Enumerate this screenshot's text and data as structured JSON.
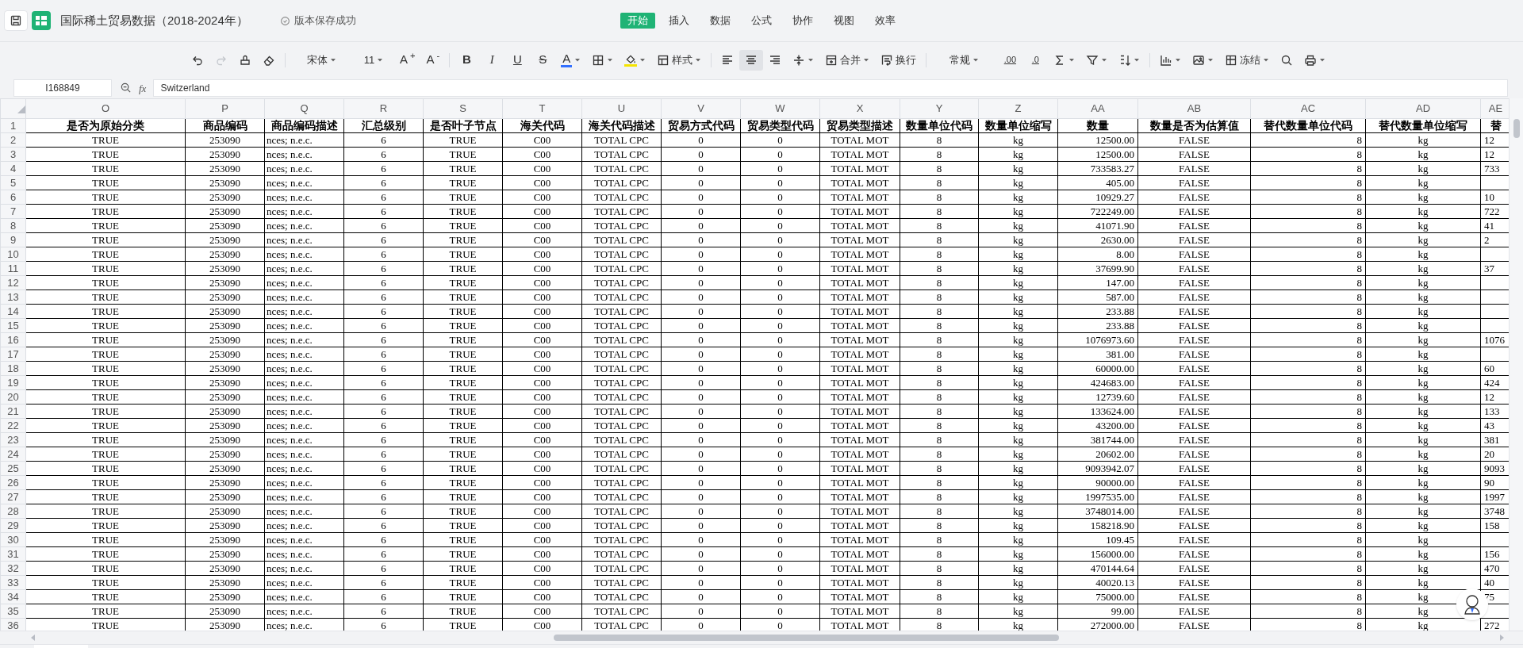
{
  "title_bar": {
    "title": "国际稀土贸易数据（2018-2024年）",
    "save_status": "版本保存成功"
  },
  "menu_tabs": [
    {
      "label": "开始",
      "selected": true
    },
    {
      "label": "插入",
      "selected": false
    },
    {
      "label": "数据",
      "selected": false
    },
    {
      "label": "公式",
      "selected": false
    },
    {
      "label": "协作",
      "selected": false
    },
    {
      "label": "视图",
      "selected": false
    },
    {
      "label": "效率",
      "selected": false
    }
  ],
  "toolbar": {
    "redo": {
      "disabled": true
    },
    "font": "宋体",
    "font_size": "11",
    "size_buttons": [
      "A$^{+}$",
      "A$^{-}$"
    ],
    "text_style_buttons": [
      "B",
      "I",
      "U",
      "S"
    ],
    "font_color_button": {
      "label": "A",
      "color": "#3370ff"
    },
    "fill_color_button": {
      "color": "#f5e400"
    },
    "style_button": "样式",
    "alignment": [
      {
        "selected": false
      },
      {
        "selected": true
      },
      {
        "selected": false
      }
    ],
    "merge_button": "合并",
    "wrap_button": "换行",
    "number_format": "常规",
    "decimal_buttons": [
      ".00",
      ".0"
    ],
    "freeze_button": "冻结"
  },
  "formula_bar": {
    "cell_reference": "I168849",
    "function_label": "fx",
    "value": "Switzerland"
  },
  "sheet": {
    "columns": [
      "O",
      "P",
      "Q",
      "R",
      "S",
      "T",
      "U",
      "V",
      "W",
      "X",
      "Y",
      "Z",
      "AA",
      "AB",
      "AC",
      "AD",
      "AE"
    ],
    "rows": [
      {
        "number": "1",
        "cells": [
          "是否为原始分类",
          "商品编码",
          "商品编码描述",
          "汇总级别",
          "是否叶子节点",
          "海关代码",
          "海关代码描述",
          "贸易方式代码",
          "贸易类型代码",
          "贸易类型描述",
          "数量单位代码",
          "数量单位缩写",
          "数量",
          "数量是否为估算值",
          "替代数量单位代码",
          "替代数量单位缩写",
          "替"
        ]
      },
      {
        "number": "2",
        "cells": [
          "TRUE",
          "253090",
          "nces; n.e.c.",
          "6",
          "TRUE",
          "C00",
          "TOTAL CPC",
          "0",
          "0",
          "TOTAL MOT",
          "8",
          "kg",
          "12500.00",
          "FALSE",
          "8",
          "kg",
          "12"
        ]
      },
      {
        "number": "3",
        "cells": [
          "TRUE",
          "253090",
          "nces; n.e.c.",
          "6",
          "TRUE",
          "C00",
          "TOTAL CPC",
          "0",
          "0",
          "TOTAL MOT",
          "8",
          "kg",
          "12500.00",
          "FALSE",
          "8",
          "kg",
          "12"
        ]
      },
      {
        "number": "4",
        "cells": [
          "TRUE",
          "253090",
          "nces; n.e.c.",
          "6",
          "TRUE",
          "C00",
          "TOTAL CPC",
          "0",
          "0",
          "TOTAL MOT",
          "8",
          "kg",
          "733583.27",
          "FALSE",
          "8",
          "kg",
          "733"
        ]
      },
      {
        "number": "5",
        "cells": [
          "TRUE",
          "253090",
          "nces; n.e.c.",
          "6",
          "TRUE",
          "C00",
          "TOTAL CPC",
          "0",
          "0",
          "TOTAL MOT",
          "8",
          "kg",
          "405.00",
          "FALSE",
          "8",
          "kg"
        ]
      },
      {
        "number": "6",
        "cells": [
          "TRUE",
          "253090",
          "nces; n.e.c.",
          "6",
          "TRUE",
          "C00",
          "TOTAL CPC",
          "0",
          "0",
          "TOTAL MOT",
          "8",
          "kg",
          "10929.27",
          "FALSE",
          "8",
          "kg",
          "10"
        ]
      },
      {
        "number": "7",
        "cells": [
          "TRUE",
          "253090",
          "nces; n.e.c.",
          "6",
          "TRUE",
          "C00",
          "TOTAL CPC",
          "0",
          "0",
          "TOTAL MOT",
          "8",
          "kg",
          "722249.00",
          "FALSE",
          "8",
          "kg",
          "722"
        ]
      },
      {
        "number": "8",
        "cells": [
          "TRUE",
          "253090",
          "nces; n.e.c.",
          "6",
          "TRUE",
          "C00",
          "TOTAL CPC",
          "0",
          "0",
          "TOTAL MOT",
          "8",
          "kg",
          "41071.90",
          "FALSE",
          "8",
          "kg",
          "41"
        ]
      },
      {
        "number": "9",
        "cells": [
          "TRUE",
          "253090",
          "nces; n.e.c.",
          "6",
          "TRUE",
          "C00",
          "TOTAL CPC",
          "0",
          "0",
          "TOTAL MOT",
          "8",
          "kg",
          "2630.00",
          "FALSE",
          "8",
          "kg",
          "2"
        ]
      },
      {
        "number": "10",
        "cells": [
          "TRUE",
          "253090",
          "nces; n.e.c.",
          "6",
          "TRUE",
          "C00",
          "TOTAL CPC",
          "0",
          "0",
          "TOTAL MOT",
          "8",
          "kg",
          "8.00",
          "FALSE",
          "8",
          "kg"
        ]
      },
      {
        "number": "11",
        "cells": [
          "TRUE",
          "253090",
          "nces; n.e.c.",
          "6",
          "TRUE",
          "C00",
          "TOTAL CPC",
          "0",
          "0",
          "TOTAL MOT",
          "8",
          "kg",
          "37699.90",
          "FALSE",
          "8",
          "kg",
          "37"
        ]
      },
      {
        "number": "12",
        "cells": [
          "TRUE",
          "253090",
          "nces; n.e.c.",
          "6",
          "TRUE",
          "C00",
          "TOTAL CPC",
          "0",
          "0",
          "TOTAL MOT",
          "8",
          "kg",
          "147.00",
          "FALSE",
          "8",
          "kg"
        ]
      },
      {
        "number": "13",
        "cells": [
          "TRUE",
          "253090",
          "nces; n.e.c.",
          "6",
          "TRUE",
          "C00",
          "TOTAL CPC",
          "0",
          "0",
          "TOTAL MOT",
          "8",
          "kg",
          "587.00",
          "FALSE",
          "8",
          "kg"
        ]
      },
      {
        "number": "14",
        "cells": [
          "TRUE",
          "253090",
          "nces; n.e.c.",
          "6",
          "TRUE",
          "C00",
          "TOTAL CPC",
          "0",
          "0",
          "TOTAL MOT",
          "8",
          "kg",
          "233.88",
          "FALSE",
          "8",
          "kg"
        ]
      },
      {
        "number": "15",
        "cells": [
          "TRUE",
          "253090",
          "nces; n.e.c.",
          "6",
          "TRUE",
          "C00",
          "TOTAL CPC",
          "0",
          "0",
          "TOTAL MOT",
          "8",
          "kg",
          "233.88",
          "FALSE",
          "8",
          "kg"
        ]
      },
      {
        "number": "16",
        "cells": [
          "TRUE",
          "253090",
          "nces; n.e.c.",
          "6",
          "TRUE",
          "C00",
          "TOTAL CPC",
          "0",
          "0",
          "TOTAL MOT",
          "8",
          "kg",
          "1076973.60",
          "FALSE",
          "8",
          "kg",
          "1076"
        ]
      },
      {
        "number": "17",
        "cells": [
          "TRUE",
          "253090",
          "nces; n.e.c.",
          "6",
          "TRUE",
          "C00",
          "TOTAL CPC",
          "0",
          "0",
          "TOTAL MOT",
          "8",
          "kg",
          "381.00",
          "FALSE",
          "8",
          "kg"
        ]
      },
      {
        "number": "18",
        "cells": [
          "TRUE",
          "253090",
          "nces; n.e.c.",
          "6",
          "TRUE",
          "C00",
          "TOTAL CPC",
          "0",
          "0",
          "TOTAL MOT",
          "8",
          "kg",
          "60000.00",
          "FALSE",
          "8",
          "kg",
          "60"
        ]
      },
      {
        "number": "19",
        "cells": [
          "TRUE",
          "253090",
          "nces; n.e.c.",
          "6",
          "TRUE",
          "C00",
          "TOTAL CPC",
          "0",
          "0",
          "TOTAL MOT",
          "8",
          "kg",
          "424683.00",
          "FALSE",
          "8",
          "kg",
          "424"
        ]
      },
      {
        "number": "20",
        "cells": [
          "TRUE",
          "253090",
          "nces; n.e.c.",
          "6",
          "TRUE",
          "C00",
          "TOTAL CPC",
          "0",
          "0",
          "TOTAL MOT",
          "8",
          "kg",
          "12739.60",
          "FALSE",
          "8",
          "kg",
          "12"
        ]
      },
      {
        "number": "21",
        "cells": [
          "TRUE",
          "253090",
          "nces; n.e.c.",
          "6",
          "TRUE",
          "C00",
          "TOTAL CPC",
          "0",
          "0",
          "TOTAL MOT",
          "8",
          "kg",
          "133624.00",
          "FALSE",
          "8",
          "kg",
          "133"
        ]
      },
      {
        "number": "22",
        "cells": [
          "TRUE",
          "253090",
          "nces; n.e.c.",
          "6",
          "TRUE",
          "C00",
          "TOTAL CPC",
          "0",
          "0",
          "TOTAL MOT",
          "8",
          "kg",
          "43200.00",
          "FALSE",
          "8",
          "kg",
          "43"
        ]
      },
      {
        "number": "23",
        "cells": [
          "TRUE",
          "253090",
          "nces; n.e.c.",
          "6",
          "TRUE",
          "C00",
          "TOTAL CPC",
          "0",
          "0",
          "TOTAL MOT",
          "8",
          "kg",
          "381744.00",
          "FALSE",
          "8",
          "kg",
          "381"
        ]
      },
      {
        "number": "24",
        "cells": [
          "TRUE",
          "253090",
          "nces; n.e.c.",
          "6",
          "TRUE",
          "C00",
          "TOTAL CPC",
          "0",
          "0",
          "TOTAL MOT",
          "8",
          "kg",
          "20602.00",
          "FALSE",
          "8",
          "kg",
          "20"
        ]
      },
      {
        "number": "25",
        "cells": [
          "TRUE",
          "253090",
          "nces; n.e.c.",
          "6",
          "TRUE",
          "C00",
          "TOTAL CPC",
          "0",
          "0",
          "TOTAL MOT",
          "8",
          "kg",
          "9093942.07",
          "FALSE",
          "8",
          "kg",
          "9093"
        ]
      },
      {
        "number": "26",
        "cells": [
          "TRUE",
          "253090",
          "nces; n.e.c.",
          "6",
          "TRUE",
          "C00",
          "TOTAL CPC",
          "0",
          "0",
          "TOTAL MOT",
          "8",
          "kg",
          "90000.00",
          "FALSE",
          "8",
          "kg",
          "90"
        ]
      },
      {
        "number": "27",
        "cells": [
          "TRUE",
          "253090",
          "nces; n.e.c.",
          "6",
          "TRUE",
          "C00",
          "TOTAL CPC",
          "0",
          "0",
          "TOTAL MOT",
          "8",
          "kg",
          "1997535.00",
          "FALSE",
          "8",
          "kg",
          "1997"
        ]
      },
      {
        "number": "28",
        "cells": [
          "TRUE",
          "253090",
          "nces; n.e.c.",
          "6",
          "TRUE",
          "C00",
          "TOTAL CPC",
          "0",
          "0",
          "TOTAL MOT",
          "8",
          "kg",
          "3748014.00",
          "FALSE",
          "8",
          "kg",
          "3748"
        ]
      },
      {
        "number": "29",
        "cells": [
          "TRUE",
          "253090",
          "nces; n.e.c.",
          "6",
          "TRUE",
          "C00",
          "TOTAL CPC",
          "0",
          "0",
          "TOTAL MOT",
          "8",
          "kg",
          "158218.90",
          "FALSE",
          "8",
          "kg",
          "158"
        ]
      },
      {
        "number": "30",
        "cells": [
          "TRUE",
          "253090",
          "nces; n.e.c.",
          "6",
          "TRUE",
          "C00",
          "TOTAL CPC",
          "0",
          "0",
          "TOTAL MOT",
          "8",
          "kg",
          "109.45",
          "FALSE",
          "8",
          "kg"
        ]
      },
      {
        "number": "31",
        "cells": [
          "TRUE",
          "253090",
          "nces; n.e.c.",
          "6",
          "TRUE",
          "C00",
          "TOTAL CPC",
          "0",
          "0",
          "TOTAL MOT",
          "8",
          "kg",
          "156000.00",
          "FALSE",
          "8",
          "kg",
          "156"
        ]
      },
      {
        "number": "32",
        "cells": [
          "TRUE",
          "253090",
          "nces; n.e.c.",
          "6",
          "TRUE",
          "C00",
          "TOTAL CPC",
          "0",
          "0",
          "TOTAL MOT",
          "8",
          "kg",
          "470144.64",
          "FALSE",
          "8",
          "kg",
          "470"
        ]
      },
      {
        "number": "33",
        "cells": [
          "TRUE",
          "253090",
          "nces; n.e.c.",
          "6",
          "TRUE",
          "C00",
          "TOTAL CPC",
          "0",
          "0",
          "TOTAL MOT",
          "8",
          "kg",
          "40020.13",
          "FALSE",
          "8",
          "kg",
          "40"
        ]
      },
      {
        "number": "34",
        "cells": [
          "TRUE",
          "253090",
          "nces; n.e.c.",
          "6",
          "TRUE",
          "C00",
          "TOTAL CPC",
          "0",
          "0",
          "TOTAL MOT",
          "8",
          "kg",
          "75000.00",
          "FALSE",
          "8",
          "kg",
          "75"
        ]
      },
      {
        "number": "35",
        "cells": [
          "TRUE",
          "253090",
          "nces; n.e.c.",
          "6",
          "TRUE",
          "C00",
          "TOTAL CPC",
          "0",
          "0",
          "TOTAL MOT",
          "8",
          "kg",
          "99.00",
          "FALSE",
          "8",
          "kg"
        ]
      },
      {
        "number": "36",
        "cells": [
          "TRUE",
          "253090",
          "nces; n.e.c.",
          "6",
          "TRUE",
          "C00",
          "TOTAL CPC",
          "0",
          "0",
          "TOTAL MOT",
          "8",
          "kg",
          "272000.00",
          "FALSE",
          "8",
          "kg",
          "272"
        ]
      }
    ]
  }
}
